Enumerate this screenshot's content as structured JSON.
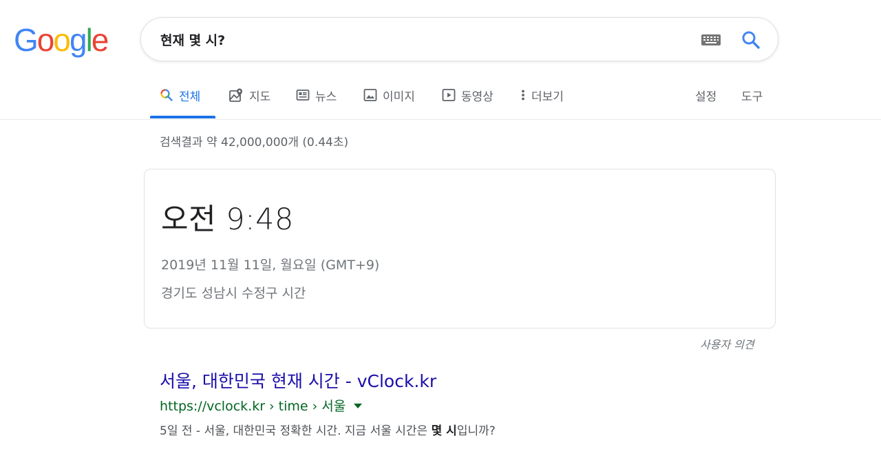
{
  "logo": {
    "letters": [
      {
        "char": "G",
        "color": "#4285F4"
      },
      {
        "char": "o",
        "color": "#EA4335"
      },
      {
        "char": "o",
        "color": "#FBBC05"
      },
      {
        "char": "g",
        "color": "#4285F4"
      },
      {
        "char": "l",
        "color": "#34A853"
      },
      {
        "char": "e",
        "color": "#EA4335"
      }
    ]
  },
  "search": {
    "query": "현재 몇 시?"
  },
  "tabs": [
    {
      "label": "전체",
      "icon": "search-icon",
      "active": true
    },
    {
      "label": "지도",
      "icon": "map-icon",
      "active": false
    },
    {
      "label": "뉴스",
      "icon": "news-icon",
      "active": false
    },
    {
      "label": "이미지",
      "icon": "image-icon",
      "active": false
    },
    {
      "label": "동영상",
      "icon": "video-icon",
      "active": false
    },
    {
      "label": "더보기",
      "icon": "more-vert-icon",
      "active": false
    }
  ],
  "tools": {
    "settings_label": "설정",
    "tools_label": "도구"
  },
  "result_stats": "검색결과 약 42,000,000개 (0.44초)",
  "time_card": {
    "time": "오전 9:48",
    "date": "2019년 11월 11일, 월요일 (GMT+9)",
    "location": "경기도 성남시 수정구 시간"
  },
  "feedback_label": "사용자 의견",
  "results": [
    {
      "title": "서울, 대한민국 현재 시간 - vClock.kr",
      "url": "https://vclock.kr › time › 서울",
      "snippet_before": "5일 전 - 서울, 대한민국 정확한 시간. 지금 서울 시간은 ",
      "snippet_bold": "몇 시",
      "snippet_after": "입니까?"
    }
  ],
  "colors": {
    "accent": "#1a73e8",
    "link": "#1a0dab",
    "url": "#006621"
  }
}
